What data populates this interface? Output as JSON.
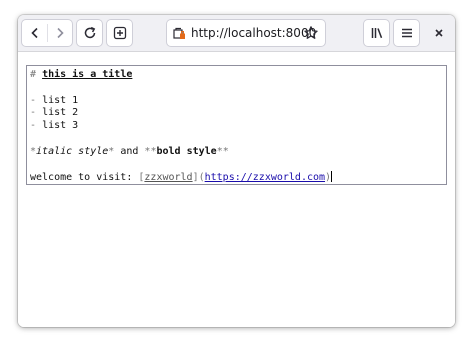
{
  "browser": {
    "url": "http://localhost:8000",
    "nav": {
      "back_icon": "back-arrow-icon",
      "forward_icon": "forward-arrow-icon"
    },
    "icons": {
      "reload": "reload-icon",
      "new_tab": "new-tab-icon",
      "site_info": "site-info-icon",
      "bookmark": "bookmark-star-icon",
      "library": "library-icon",
      "menu": "hamburger-menu-icon",
      "close": "close-icon"
    }
  },
  "editor": {
    "title_marker": "#",
    "title_text": "this is a title",
    "list_marker": "-",
    "list_items": [
      "list 1",
      "list 2",
      "list 3"
    ],
    "italic_marker": "*",
    "italic_text": "italic style",
    "and_text": " and ",
    "bold_marker": "**",
    "bold_text": "bold style",
    "link_prefix": "welcome to visit: ",
    "link_open_bracket": "[",
    "link_label": "zzxworld",
    "link_mid": "](",
    "link_url": "https://zzxworld.com",
    "link_close": ")"
  }
}
